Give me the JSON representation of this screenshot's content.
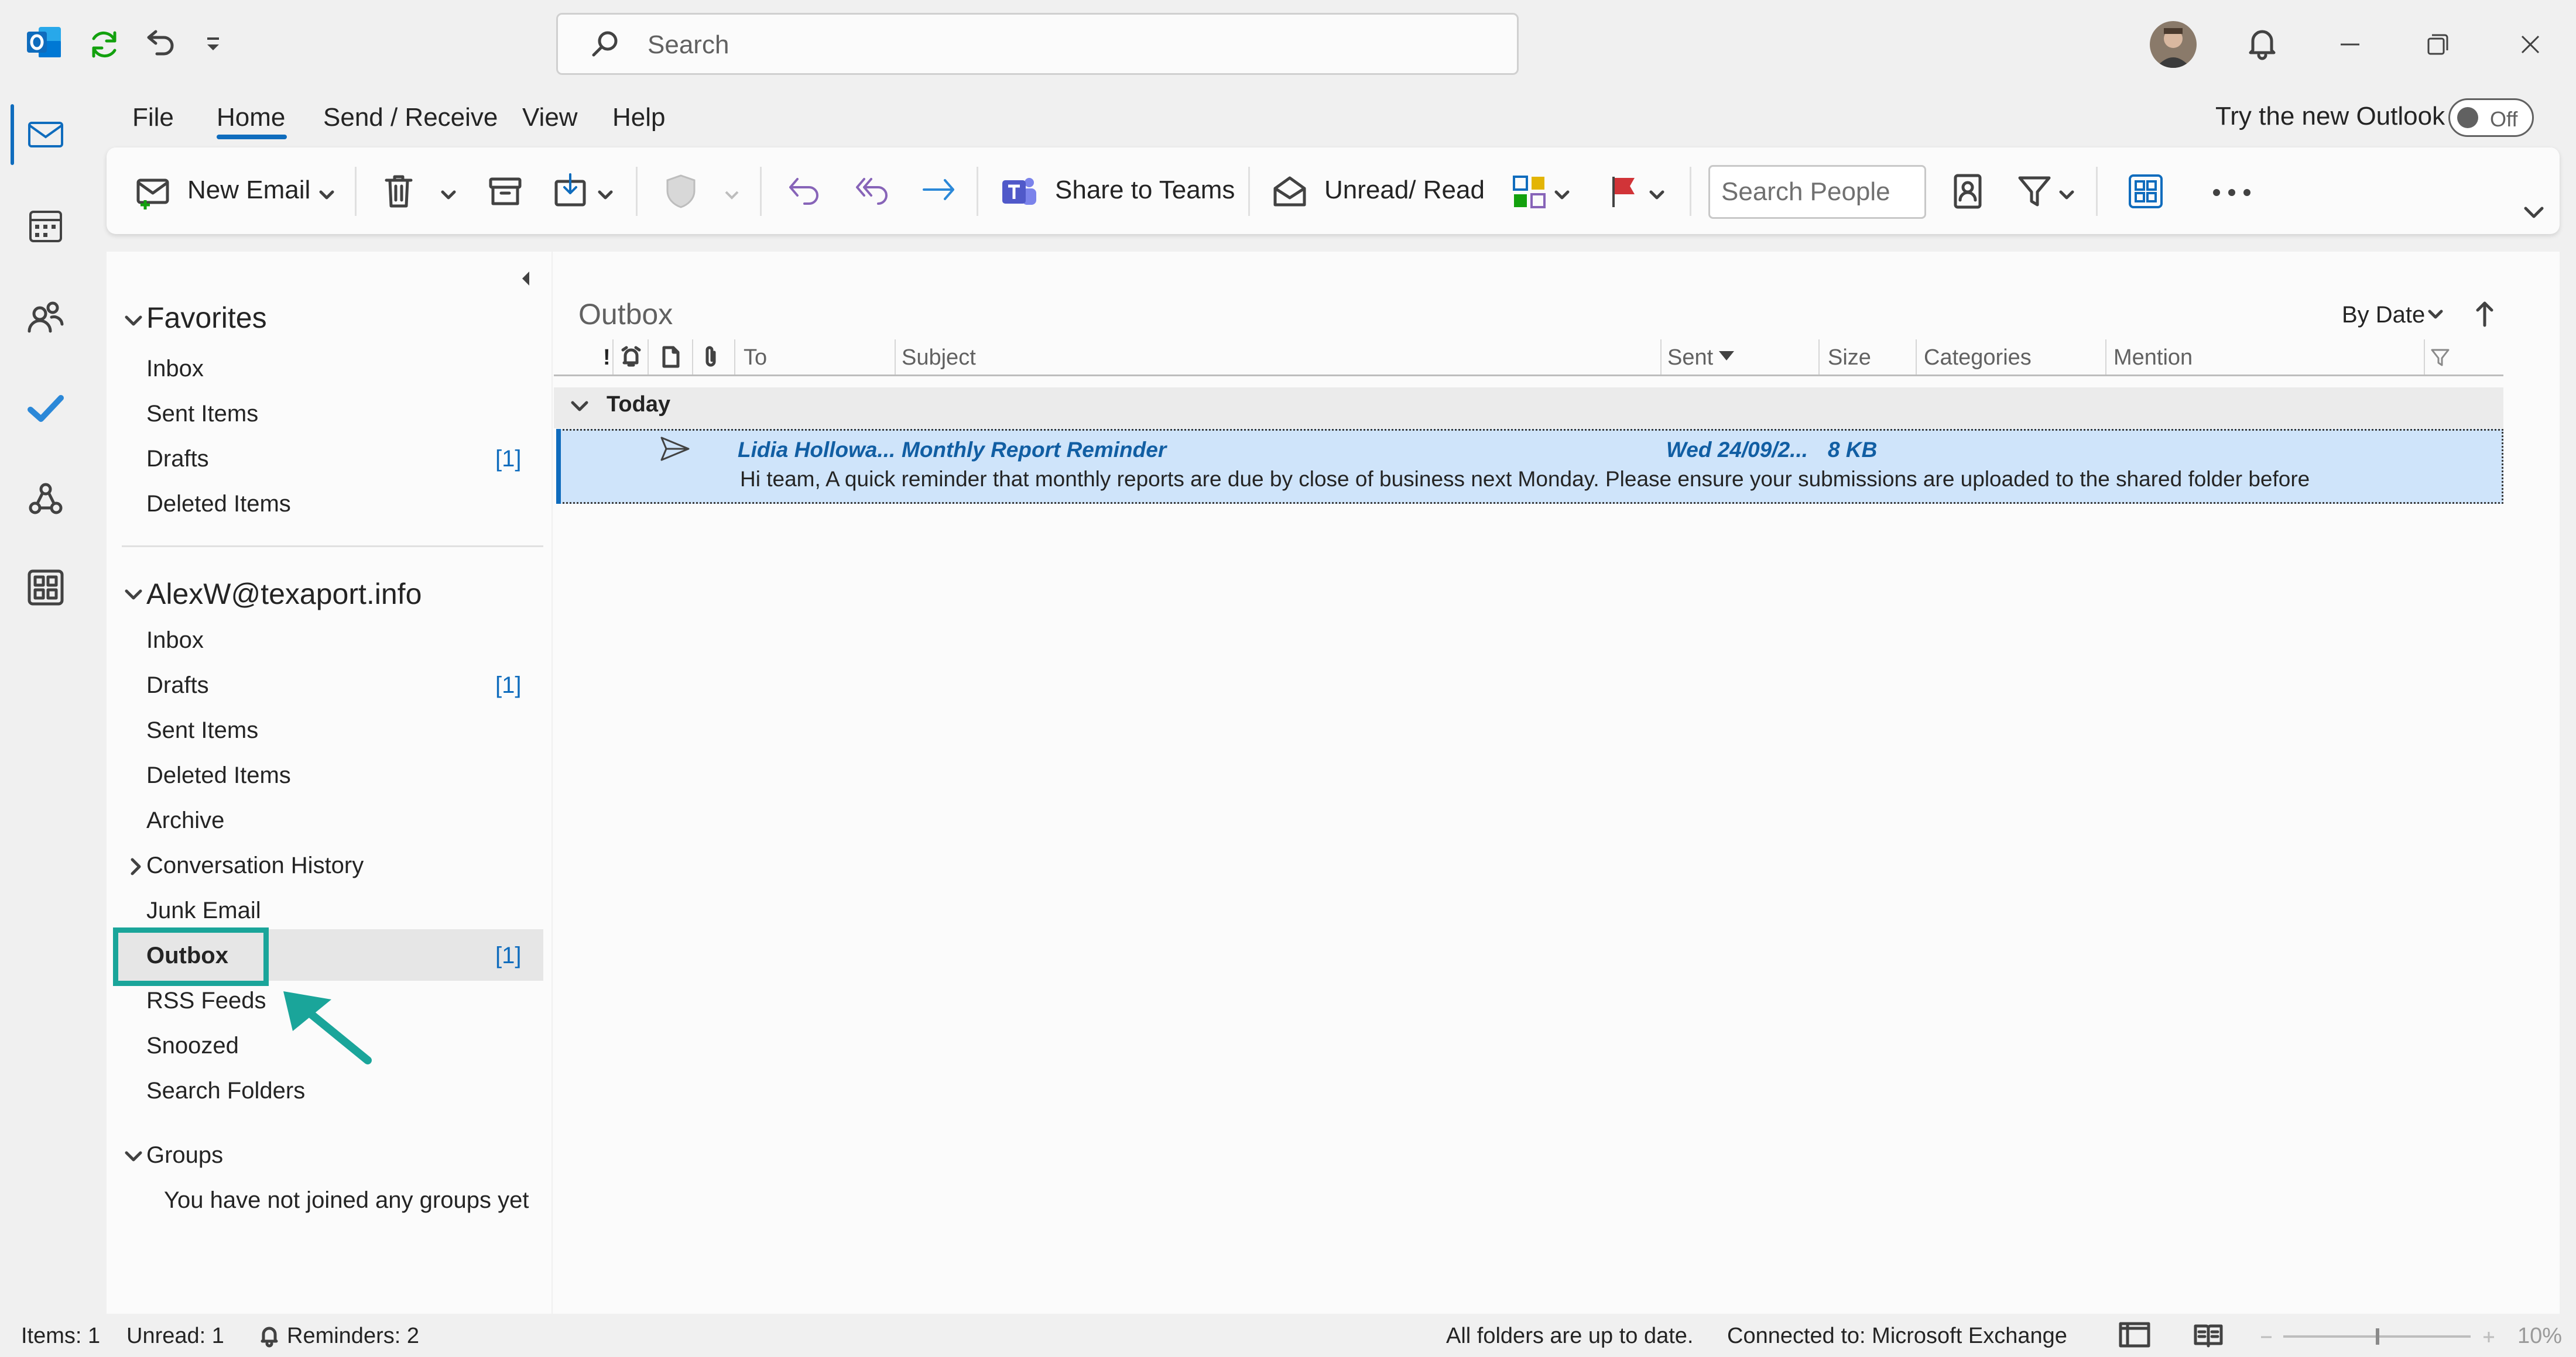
{
  "window": {
    "search_label": "Search"
  },
  "menu": {
    "tabs": [
      "File",
      "Home",
      "Send / Receive",
      "View",
      "Help"
    ],
    "active_tab": "Home",
    "try_new_outlook": "Try the new Outlook",
    "toggle_label": "Off"
  },
  "ribbon": {
    "new_email": "New Email",
    "share_to_teams": "Share to Teams",
    "unread_read": "Unread/ Read",
    "search_people_placeholder": "Search People"
  },
  "folders": {
    "favorites_header": "Favorites",
    "favorites": [
      {
        "label": "Inbox",
        "count": ""
      },
      {
        "label": "Sent Items",
        "count": ""
      },
      {
        "label": "Drafts",
        "count": "[1]"
      },
      {
        "label": "Deleted Items",
        "count": ""
      }
    ],
    "account_header": "AlexW@texaport.info",
    "account": [
      {
        "label": "Inbox",
        "count": ""
      },
      {
        "label": "Drafts",
        "count": "[1]"
      },
      {
        "label": "Sent Items",
        "count": ""
      },
      {
        "label": "Deleted Items",
        "count": ""
      },
      {
        "label": "Archive",
        "count": ""
      },
      {
        "label": "Conversation History",
        "count": ""
      },
      {
        "label": "Junk Email",
        "count": ""
      },
      {
        "label": "Outbox",
        "count": "[1]"
      },
      {
        "label": "RSS Feeds",
        "count": ""
      },
      {
        "label": "Snoozed",
        "count": ""
      },
      {
        "label": "Search Folders",
        "count": ""
      }
    ],
    "groups_header": "Groups",
    "groups_empty": "You have not joined any groups yet"
  },
  "list": {
    "title": "Outbox",
    "sort_label": "By Date",
    "columns": {
      "importance": "!",
      "to": "To",
      "subject": "Subject",
      "sent": "Sent",
      "size": "Size",
      "categories": "Categories",
      "mention": "Mention"
    },
    "group_label": "Today",
    "messages": [
      {
        "to": "Lidia Hollowa...",
        "subject": "Monthly Report Reminder",
        "sent": "Wed 24/09/2...",
        "size": "8 KB",
        "preview": "Hi team,  A quick reminder that monthly reports are due by close of business next Monday. Please ensure your submissions are uploaded to the shared folder before"
      }
    ]
  },
  "status": {
    "items": "Items: 1",
    "unread": "Unread: 1",
    "reminders": "Reminders: 2",
    "sync": "All folders are up to date.",
    "connection": "Connected to: Microsoft Exchange",
    "zoom": "10%"
  },
  "colors": {
    "accent": "#0f6cbd",
    "annotation": "#1aa59a",
    "selection": "#cfe4fa"
  }
}
